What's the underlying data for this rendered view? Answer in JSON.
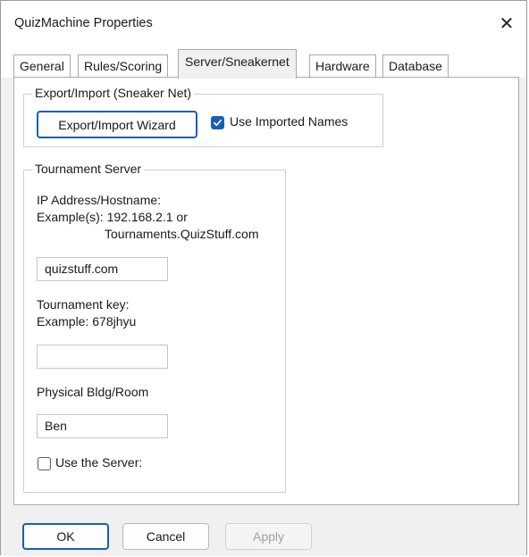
{
  "window": {
    "title": "QuizMachine Properties",
    "close_glyph": "✕"
  },
  "tabs": [
    {
      "label": "General",
      "active": false
    },
    {
      "label": "Rules/Scoring",
      "active": false
    },
    {
      "label": "Server/Sneakernet",
      "active": true
    },
    {
      "label": "Hardware",
      "active": false
    },
    {
      "label": "Database",
      "active": false
    }
  ],
  "export_import": {
    "group_title": "Export/Import (Sneaker Net)",
    "wizard_button": "Export/Import Wizard",
    "use_imported_names_label": "Use Imported Names",
    "use_imported_names_checked": true
  },
  "tournament_server": {
    "group_title": "Tournament Server",
    "ip_label_line1": "IP Address/Hostname:",
    "ip_label_line2": "Example(s): 192.168.2.1 or",
    "ip_label_line3": "Tournaments.QuizStuff.com",
    "ip_value": "quizstuff.com",
    "key_label_line1": "Tournament key:",
    "key_label_line2": "Example: 678jhyu",
    "key_value": "",
    "room_label": "Physical Bldg/Room",
    "room_value": "Ben",
    "use_server_label": "Use the Server:",
    "use_server_checked": false
  },
  "footer": {
    "ok_label": "OK",
    "cancel_label": "Cancel",
    "apply_label": "Apply"
  },
  "colors": {
    "accent": "#1a5fb4",
    "dialog_bg": "#f0f0f0"
  }
}
